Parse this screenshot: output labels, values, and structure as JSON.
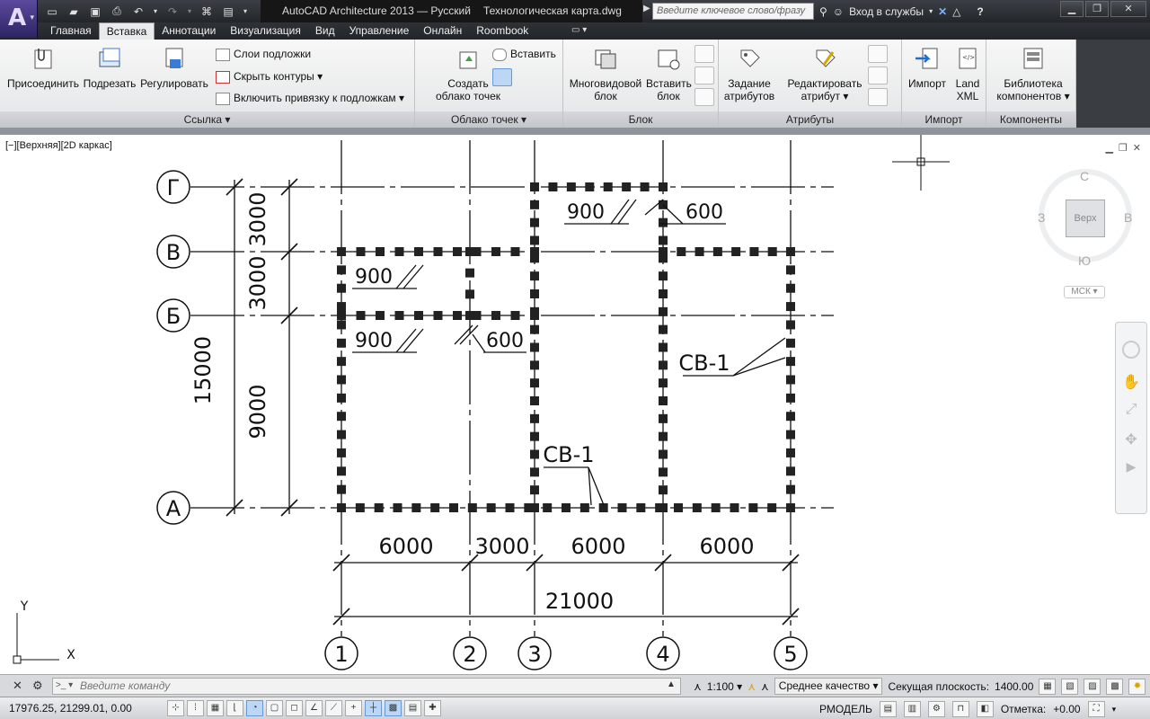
{
  "titlebar": {
    "app_name": "AutoCAD Architecture 2013 — Русский",
    "file_name": "Технологическая карта.dwg",
    "search_placeholder": "Введите ключевое слово/фразу",
    "signin_label": "Вход в службы",
    "help_label": "?"
  },
  "tabs": [
    "Главная",
    "Вставка",
    "Аннотации",
    "Визуализация",
    "Вид",
    "Управление",
    "Онлайн",
    "Roombook"
  ],
  "active_tab": "Вставка",
  "ribbon": {
    "panels": {
      "reference": "Ссылка",
      "pointcloud": "Облако точек",
      "block": "Блок",
      "attributes": "Атрибуты",
      "import": "Импорт",
      "components": "Компоненты"
    },
    "buttons": {
      "attach": "Присоединить",
      "clip": "Подрезать",
      "adjust": "Регулировать",
      "underlay_layers": "Слои подложки",
      "hide_frames": "Скрыть контуры",
      "snap_underlays": "Включить привязку к подложкам",
      "create_pointcloud_1": "Создать",
      "create_pointcloud_2": "облако точек",
      "insert_pc": "Вставить",
      "multiview_1": "Многовидовой",
      "multiview_2": "блок",
      "insert_block_1": "Вставить",
      "insert_block_2": "блок",
      "define_attr_1": "Задание",
      "define_attr_2": "атрибутов",
      "edit_attr_1": "Редактировать",
      "edit_attr_2": "атрибут",
      "import": "Импорт",
      "landxml_1": "Land",
      "landxml_2": "XML",
      "library_1": "Библиотека",
      "library_2": "компонентов"
    }
  },
  "viewport": {
    "label": "[−][Верхняя][2D каркас]",
    "viewcube": {
      "top": "Верх",
      "north": "С",
      "south": "Ю",
      "west": "З",
      "east": "В",
      "ucs": "МСК"
    }
  },
  "drawing": {
    "axes_rows": [
      "Г",
      "В",
      "Б",
      "А"
    ],
    "axes_cols": [
      "1",
      "2",
      "3",
      "4",
      "5"
    ],
    "dims_vertical": [
      "3000",
      "3000",
      "9000",
      "15000"
    ],
    "dims_horizontal": [
      "6000",
      "3000",
      "6000",
      "6000",
      "21000"
    ],
    "dims_local": [
      "900",
      "600",
      "900",
      "900",
      "600"
    ],
    "labels": [
      "СВ-1",
      "СВ-1"
    ],
    "ucs_x": "X",
    "ucs_y": "Y"
  },
  "cmdline": {
    "placeholder": "Введите команду",
    "scale": "1:100",
    "quality": "Среднее качество",
    "cut_plane_label": "Секущая плоскость:",
    "cut_plane_value": "1400.00"
  },
  "statusbar": {
    "coords": "17976.25, 21299.01, 0.00",
    "space": "РМОДЕЛЬ",
    "elevation_label": "Отметка:",
    "elevation_value": "+0.00"
  }
}
